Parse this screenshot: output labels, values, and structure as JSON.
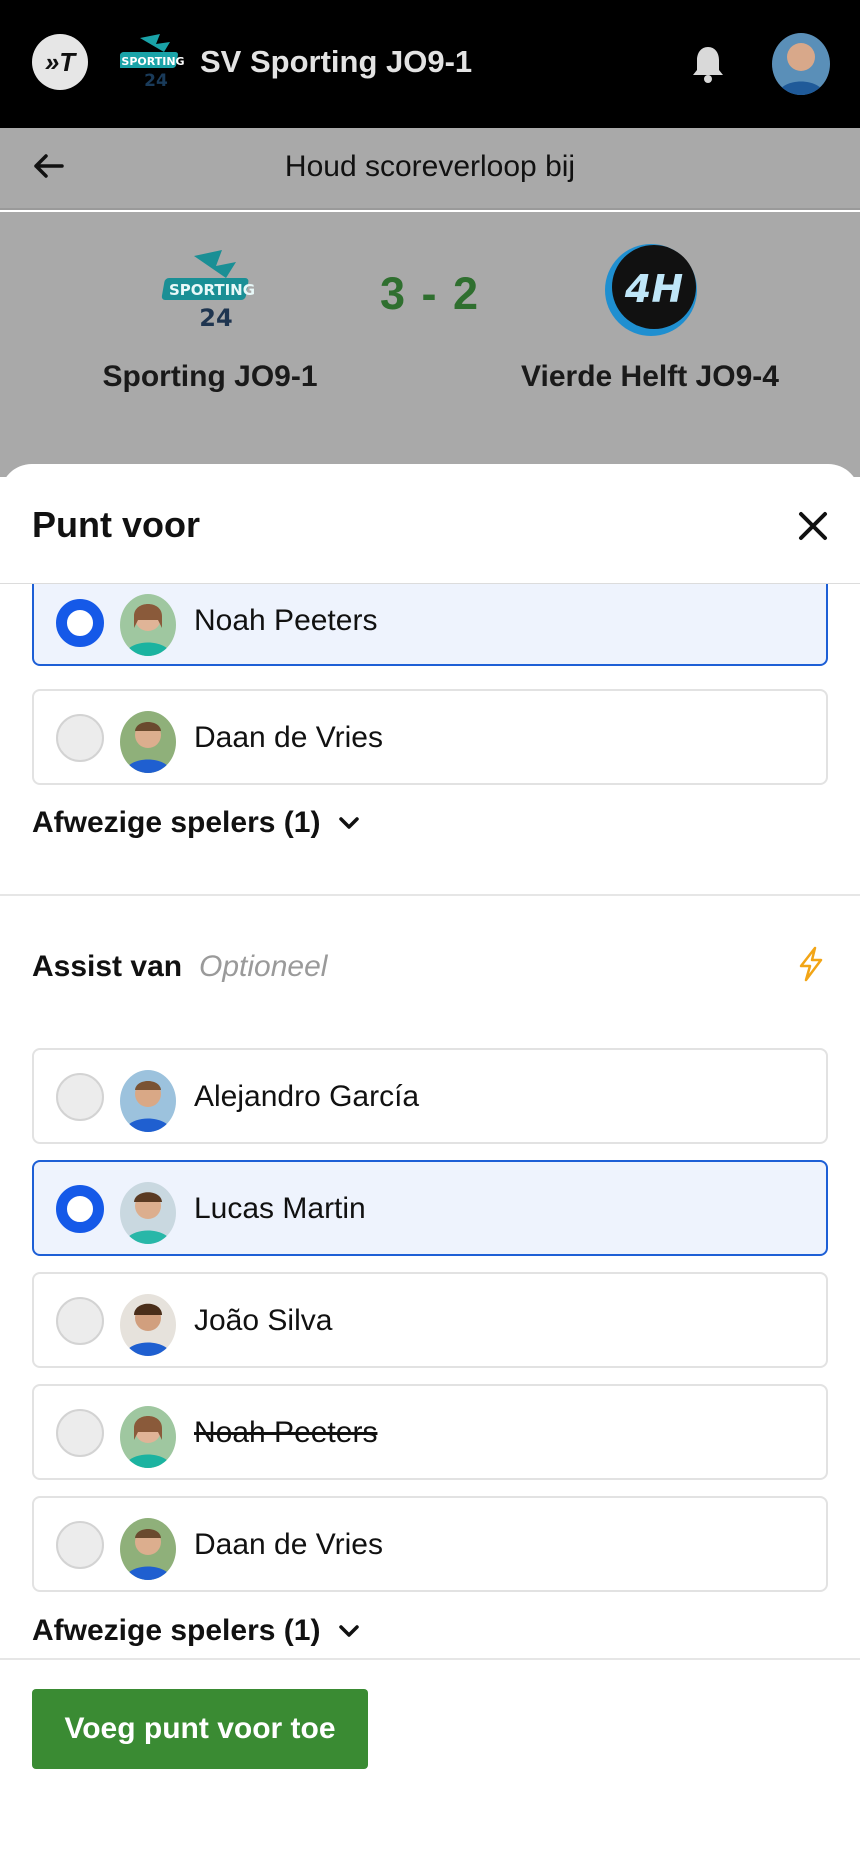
{
  "app_bar": {
    "team_name": "SV Sporting JO9-1",
    "app_logo_text": "»T"
  },
  "subheader": {
    "title": "Houd scoreverloop bij"
  },
  "scoreboard": {
    "score": "3 - 2",
    "home_team": "Sporting JO9-1",
    "away_team": "Vierde Helft JO9-4",
    "home_crest_text": "SPORTING 24",
    "away_crest_text": "4H"
  },
  "sheet": {
    "title": "Punt voor",
    "scorer_players": [
      {
        "name": "Noah Peeters",
        "selected": true,
        "absent": false
      },
      {
        "name": "Daan de Vries",
        "selected": false,
        "absent": false
      }
    ],
    "scorer_absent_label": "Afwezige spelers (1)",
    "assist_label": "Assist van",
    "assist_optional": "Optioneel",
    "assist_players": [
      {
        "name": "Alejandro García",
        "selected": false,
        "absent": false
      },
      {
        "name": "Lucas Martin",
        "selected": true,
        "absent": false
      },
      {
        "name": "João Silva",
        "selected": false,
        "absent": false
      },
      {
        "name": "Noah Peeters",
        "selected": false,
        "absent": false,
        "struck": true
      },
      {
        "name": "Daan de Vries",
        "selected": false,
        "absent": false
      }
    ],
    "assist_absent_label": "Afwezige spelers (1)",
    "submit_label": "Voeg punt voor toe"
  },
  "colors": {
    "accent_blue": "#1559e8",
    "submit_green": "#3a8b33",
    "score_green": "#2f6f2f",
    "bolt_orange": "#f2a516"
  },
  "icons": [
    "app-logo-icon",
    "bell-icon",
    "back-arrow-icon",
    "close-icon",
    "chevron-down-icon",
    "lightning-icon"
  ]
}
